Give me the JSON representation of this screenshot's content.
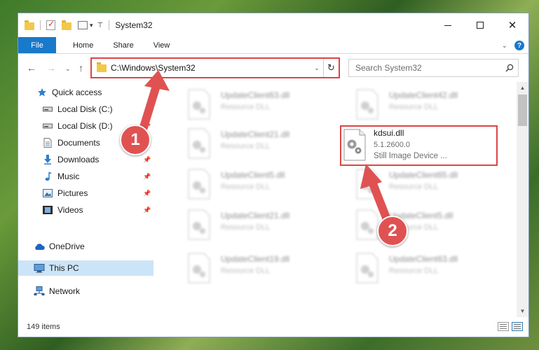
{
  "window": {
    "title": "System32",
    "caption": {
      "minimize": "minimize",
      "maximize": "maximize",
      "close": "✕"
    }
  },
  "ribbon": {
    "tabs": [
      "File",
      "Home",
      "Share",
      "View"
    ]
  },
  "address": {
    "path": "C:\\Windows\\System32",
    "search_placeholder": "Search System32"
  },
  "nav": {
    "items": [
      {
        "label": "Quick access",
        "icon": "star-icon",
        "pinned": false
      },
      {
        "label": "Local Disk (C:)",
        "icon": "drive-icon",
        "pinned": false
      },
      {
        "label": "Local Disk (D:)",
        "icon": "drive-icon",
        "pinned": true
      },
      {
        "label": "Documents",
        "icon": "documents-icon",
        "pinned": true
      },
      {
        "label": "Downloads",
        "icon": "download-icon",
        "pinned": true
      },
      {
        "label": "Music",
        "icon": "music-icon",
        "pinned": true
      },
      {
        "label": "Pictures",
        "icon": "pictures-icon",
        "pinned": true
      },
      {
        "label": "Videos",
        "icon": "videos-icon",
        "pinned": true
      },
      {
        "label": "OneDrive",
        "icon": "cloud-icon",
        "pinned": false
      },
      {
        "label": "This PC",
        "icon": "computer-icon",
        "pinned": false,
        "selected": true
      },
      {
        "label": "Network",
        "icon": "network-icon",
        "pinned": false
      }
    ]
  },
  "files": {
    "left": [
      {
        "name": "UpdateClient63.dll",
        "type": "Resource DLL"
      },
      {
        "name": "UpdateClient21.dll",
        "type": "Resource DLL"
      },
      {
        "name": "UpdateClient5.dll",
        "type": "Resource DLL"
      },
      {
        "name": "UpdateClient21.dll",
        "type": "Resource DLL"
      },
      {
        "name": "UpdateClient19.dll",
        "type": "Resource DLL"
      }
    ],
    "right": [
      {
        "name": "UpdateClient42.dll",
        "type": "Resource DLL"
      },
      {
        "name": "UpdateClient65.dll",
        "type": "Resource DLL"
      },
      {
        "name": "UpdateClient5.dll",
        "type": "Resource DLL"
      },
      {
        "name": "UpdateClient63.dll",
        "type": "Resource DLL"
      }
    ],
    "highlighted": {
      "name": "kdsui.dll",
      "version": "5.1.2600.0",
      "description": "Still Image Device ..."
    }
  },
  "status": {
    "item_count": "149 items"
  },
  "annotations": {
    "step1": "1",
    "step2": "2"
  },
  "colors": {
    "accent": "#1979ca",
    "highlight": "#dc4545",
    "badge": "#e05252",
    "selected": "#cce4f7"
  }
}
